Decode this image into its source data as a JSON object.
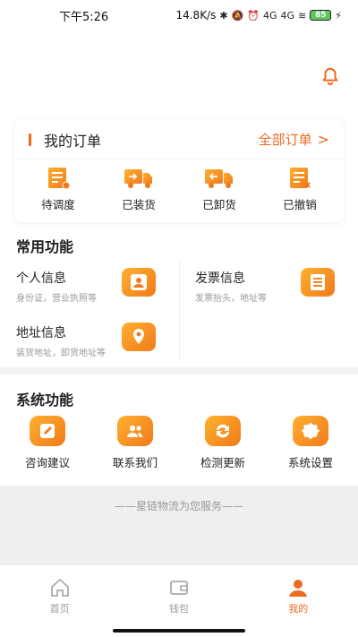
{
  "status_bar": {
    "time": "下午5:26",
    "network_speed": "14.8K/s",
    "signal1": "4G",
    "signal2": "4G",
    "battery": "85"
  },
  "orders": {
    "title": "我的订单",
    "all_label": "全部订单",
    "items": [
      {
        "label": "待调度",
        "icon": "dispatch-icon"
      },
      {
        "label": "已装货",
        "icon": "loaded-truck-icon"
      },
      {
        "label": "已卸货",
        "icon": "unloaded-truck-icon"
      },
      {
        "label": "已撤销",
        "icon": "cancelled-doc-icon"
      }
    ]
  },
  "common": {
    "title": "常用功能",
    "items": [
      {
        "title": "个人信息",
        "subtitle": "身份证，营业执照等",
        "icon": "person-icon"
      },
      {
        "title": "发票信息",
        "subtitle": "发票抬头，地址等",
        "icon": "invoice-icon"
      },
      {
        "title": "地址信息",
        "subtitle": "装货地址，卸货地址等",
        "icon": "location-icon"
      }
    ]
  },
  "system": {
    "title": "系统功能",
    "items": [
      {
        "label": "咨询建议",
        "icon": "edit-icon"
      },
      {
        "label": "联系我们",
        "icon": "contacts-icon"
      },
      {
        "label": "检测更新",
        "icon": "refresh-icon"
      },
      {
        "label": "系统设置",
        "icon": "settings-icon"
      }
    ]
  },
  "slogan": "——星链物流为您服务——",
  "tabbar": {
    "tabs": [
      {
        "label": "首页",
        "icon": "home-icon"
      },
      {
        "label": "钱包",
        "icon": "wallet-icon"
      },
      {
        "label": "我的",
        "icon": "user-icon"
      }
    ],
    "active": "我的"
  },
  "colors": {
    "accent": "#ef6a1e",
    "icon_gradient_start": "#ffb030",
    "icon_gradient_end": "#f07a1a"
  }
}
